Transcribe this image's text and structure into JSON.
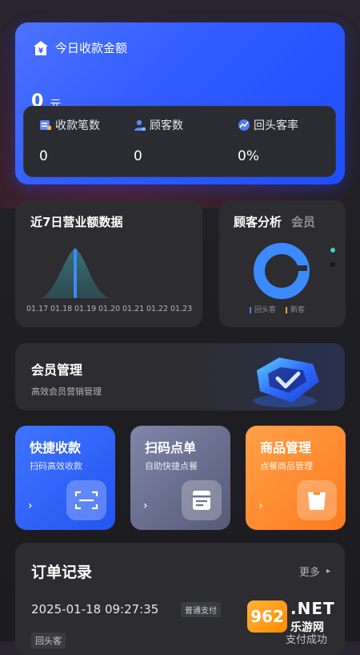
{
  "summary": {
    "title": "今日收款金额",
    "amount": "0",
    "unit": "元",
    "stats": [
      {
        "label": "收款笔数",
        "value": "0",
        "icon": "receipt-icon"
      },
      {
        "label": "顾客数",
        "value": "0",
        "icon": "customer-icon"
      },
      {
        "label": "回头客率",
        "value": "0%",
        "icon": "trend-icon"
      }
    ]
  },
  "sales": {
    "title": "近7日营业额数据",
    "dates": [
      "01.17",
      "01.18",
      "01.19",
      "01.20",
      "01.21",
      "01.22",
      "01.23"
    ]
  },
  "customer": {
    "tab_active": "顾客分析",
    "tab_other": "会员",
    "legend": [
      "回头客",
      "新客"
    ],
    "colors": {
      "returning": "#3b8bff",
      "new": "#f09a3e"
    }
  },
  "member": {
    "title": "会员管理",
    "subtitle": "高效会员营销管理"
  },
  "tiles": [
    {
      "title": "快捷收款",
      "subtitle": "扫码高效收款",
      "arrow": "›",
      "icon": "scan-icon"
    },
    {
      "title": "扫码点单",
      "subtitle": "自助快捷点餐",
      "arrow": "›",
      "icon": "menu-icon"
    },
    {
      "title": "商品管理",
      "subtitle": "点餐商品管理",
      "arrow": "›",
      "icon": "bag-icon"
    }
  ],
  "orders": {
    "title": "订单记录",
    "more": "更多",
    "more_arrow": "▸",
    "time": "2025-01-18 09:27:35",
    "pay_type": "普通支付",
    "tag": "回头客",
    "status": "支付成功"
  },
  "watermark": {
    "badge": "962",
    "text": ".NET",
    "sub": "乐游网"
  },
  "colors": {
    "accent_blue": "#2f5bff",
    "card_bg": "#2c2c31",
    "orange": "#ff8a2a"
  }
}
